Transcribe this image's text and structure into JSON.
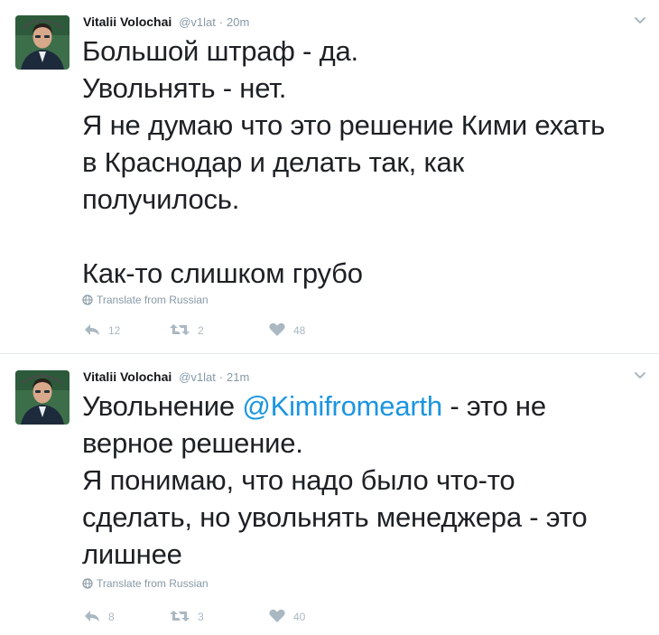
{
  "tweets": [
    {
      "display_name": "Vitalii Volochai",
      "handle": "@v1lat",
      "separator": "·",
      "time": "20m",
      "lines": [
        "Большой штраф - да.",
        "Увольнять - нет.",
        "Я не думаю что это решение Кими ехать",
        "в Краснодар и делать так, как",
        "получилось.",
        "",
        "Как-то слишком грубо"
      ],
      "translate_label": "Translate from Russian",
      "replies": "12",
      "retweets": "2",
      "likes": "48"
    },
    {
      "display_name": "Vitalii Volochai",
      "handle": "@v1lat",
      "separator": "·",
      "time": "21m",
      "line1_before": "Увольнение ",
      "mention": "@Kimifromearth",
      "line1_after": " - это не",
      "lines": [
        "верное решение.",
        "Я понимаю, что надо было что-то",
        "сделать, но увольнять менеджера - это",
        "лишнее"
      ],
      "translate_label": "Translate from Russian",
      "replies": "8",
      "retweets": "3",
      "likes": "40"
    }
  ],
  "colors": {
    "mention": "#1b95e0",
    "muted": "#8899a6",
    "action_icon": "#aab8c2"
  },
  "icons": {
    "avatar": "user-avatar-photo",
    "menu": "chevron-down-icon",
    "translate": "globe-icon",
    "reply": "reply-icon",
    "retweet": "retweet-icon",
    "like": "heart-icon"
  }
}
